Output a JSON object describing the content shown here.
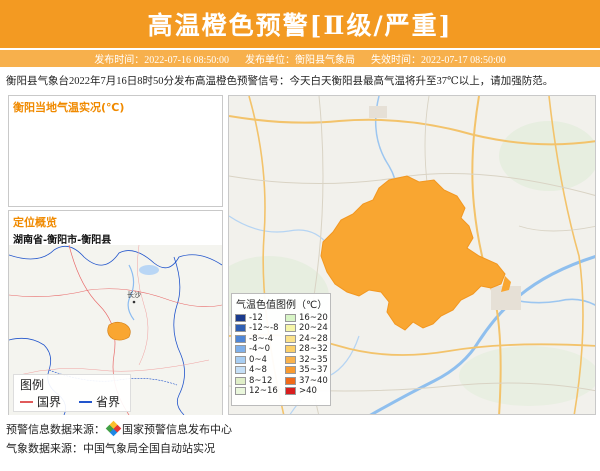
{
  "header": {
    "title": "高温橙色预警[Ⅱ级/严重]"
  },
  "meta": {
    "issue_time": "发布时间：2022-07-16 08:50:00",
    "issuer": "发布单位：衡阳县气象局",
    "expire_time": "失效时间：2022-07-17 08:50:00"
  },
  "notice": "衡阳县气象台2022年7月16日8时50分发布高温橙色预警信号：今天白天衡阳县最高气温将升至37℃以上，请加强防范。",
  "temp_panel": {
    "title": "衡阳当地气温实况(℃)"
  },
  "location_panel": {
    "title": "定位概览",
    "path": "湖南省-衡阳市-衡阳县",
    "map_labels": {
      "changsha": "长沙"
    },
    "legend": {
      "title": "图例",
      "items": [
        "国界",
        "省界"
      ]
    }
  },
  "legend": {
    "title": "气温色值图例（℃）",
    "items": [
      {
        "label": "-12",
        "color": "#1a3a8c"
      },
      {
        "label": "16~20",
        "color": "#d8f5c6"
      },
      {
        "label": "-12~-8",
        "color": "#2f5fb3"
      },
      {
        "label": "20~24",
        "color": "#f6f6a8"
      },
      {
        "label": "-8~-4",
        "color": "#4f86d6"
      },
      {
        "label": "24~28",
        "color": "#fbe28a"
      },
      {
        "label": "-4~0",
        "color": "#7fb0ea"
      },
      {
        "label": "28~32",
        "color": "#fbd06a"
      },
      {
        "label": "0~4",
        "color": "#a8cef3"
      },
      {
        "label": "32~35",
        "color": "#f9b24c"
      },
      {
        "label": "4~8",
        "color": "#c6e0f7"
      },
      {
        "label": "35~37",
        "color": "#f89a30"
      },
      {
        "label": "8~12",
        "color": "#e0efc8"
      },
      {
        "label": "37~40",
        "color": "#f06a1a"
      },
      {
        "label": "12~16",
        "color": "#eaf7dc"
      },
      {
        "label": ">40",
        "color": "#d81e1e"
      }
    ]
  },
  "footer": {
    "source_label": "预警信息数据来源：",
    "source_org": "国家预警信息发布中心",
    "weather_source": "气象数据来源：中国气象局全国自动站实况"
  },
  "colors": {
    "banner": "#f39a22",
    "meta_bar": "#f7b04c",
    "panel_title": "#f08a00",
    "warning_area": "#f9a631",
    "national_border": "#e05a5a",
    "provincial_border": "#2255cc"
  }
}
